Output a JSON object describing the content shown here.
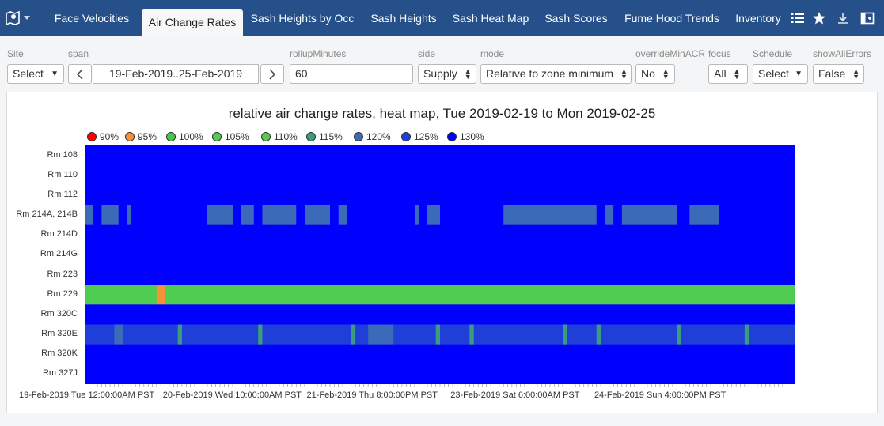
{
  "nav": {
    "tabs": [
      {
        "label": "Face Velocities",
        "active": false
      },
      {
        "label": "Air Change Rates",
        "active": true
      },
      {
        "label": "Sash Heights by Occ",
        "active": false
      },
      {
        "label": "Sash Heights",
        "active": false
      },
      {
        "label": "Sash Heat Map",
        "active": false
      },
      {
        "label": "Sash Scores",
        "active": false
      },
      {
        "label": "Fume Hood Trends",
        "active": false
      },
      {
        "label": "Inventory",
        "active": false
      }
    ],
    "icons": [
      "map-pin-icon",
      "list-icon",
      "star-icon",
      "download-icon",
      "panel-icon"
    ]
  },
  "params": {
    "site": {
      "label": "Site",
      "value": "Select"
    },
    "span": {
      "label": "span",
      "value": "19-Feb-2019..25-Feb-2019"
    },
    "rollup": {
      "label": "rollupMinutes",
      "value": "60"
    },
    "side": {
      "label": "side",
      "value": "Supply"
    },
    "mode": {
      "label": "mode",
      "value": "Relative to zone minimum"
    },
    "override": {
      "label": "overrideMinACR",
      "value": "No"
    },
    "focus": {
      "label": "focus",
      "value": "All"
    },
    "schedule": {
      "label": "Schedule",
      "value": "Select"
    },
    "errors": {
      "label": "showAllErrors",
      "value": "False"
    }
  },
  "colors": {
    "nav_bg": "#26508a",
    "scale": [
      "#ff0000",
      "#f5923a",
      "#45c94a",
      "#4fcc52",
      "#5ac855",
      "#3c9a80",
      "#3a6ab8",
      "#1f3fd8",
      "#0000ff"
    ]
  },
  "chart_data": {
    "type": "heatmap",
    "title": "relative air change rates, heat map, Tue 2019-02-19 to Mon 2019-02-25",
    "legend": [
      "90%",
      "95%",
      "100%",
      "105%",
      "110%",
      "115%",
      "120%",
      "125%",
      "130%"
    ],
    "rows": [
      "Rm 108",
      "Rm 110",
      "Rm 112",
      "Rm 214A, 214B",
      "Rm 214D",
      "Rm 214G",
      "Rm 223",
      "Rm 229",
      "Rm 320C",
      "Rm 320E",
      "Rm 320K",
      "Rm 327J"
    ],
    "x_tick_labels": [
      "19-Feb-2019 Tue 12:00:00AM PST",
      "20-Feb-2019 Wed 10:00:00AM PST",
      "21-Feb-2019 Thu 8:00:00PM PST",
      "23-Feb-2019 Sat 6:00:00AM PST",
      "24-Feb-2019 Sun 4:00:00PM PST"
    ],
    "x_ticks_hours": [
      0,
      34,
      68,
      102,
      136
    ],
    "hours": 168,
    "default_value": 130,
    "row_values": {
      "Rm 229": 105,
      "Rm 320E": 125
    },
    "cell_overrides": [
      {
        "row": "Rm 214A, 214B",
        "hours": [
          0,
          1,
          4,
          5,
          6,
          7,
          10,
          29,
          30,
          31,
          32,
          33,
          34,
          37,
          38,
          39,
          42,
          43,
          44,
          45,
          46,
          47,
          48,
          49,
          52,
          53,
          54,
          55,
          56,
          57,
          60,
          61,
          78,
          81,
          82,
          83,
          99,
          100,
          101,
          102,
          103,
          104,
          105,
          106,
          107,
          108,
          109,
          110,
          111,
          112,
          113,
          114,
          115,
          116,
          117,
          118,
          119,
          120,
          123,
          124,
          127,
          128,
          129,
          130,
          131,
          132,
          133,
          134,
          135,
          136,
          137,
          138,
          139,
          143,
          144,
          145,
          146,
          147,
          148,
          149
        ],
        "value": 120
      },
      {
        "row": "Rm 229",
        "hours": [
          17,
          18
        ],
        "value": 95
      },
      {
        "row": "Rm 320E",
        "hours": [
          7,
          8,
          67,
          68,
          69,
          70,
          71,
          72
        ],
        "value": 120
      },
      {
        "row": "Rm 320E",
        "hours": [
          22,
          41,
          63,
          83,
          91,
          113,
          121,
          140,
          156
        ],
        "value": 115
      }
    ]
  }
}
